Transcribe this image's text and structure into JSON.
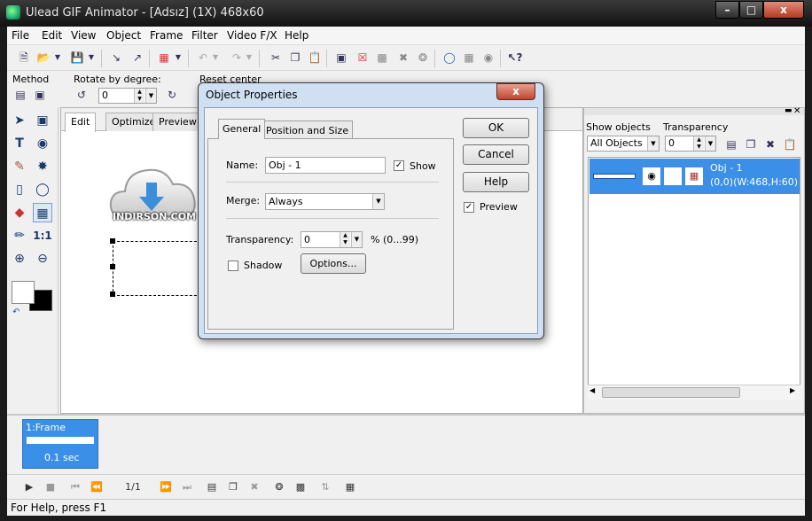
{
  "window": {
    "title": "Ulead GIF Animator - [Adsız] (1X) 468x60",
    "min_label": "–",
    "max_label": "□",
    "close_label": "x"
  },
  "menu": [
    "File",
    "Edit",
    "View",
    "Object",
    "Frame",
    "Filter",
    "Video F/X",
    "Help"
  ],
  "propbar": {
    "method_label": "Method",
    "rotate_label": "Rotate by degree:",
    "rotate_value": "0",
    "reset_label": "Reset center"
  },
  "workspace": {
    "tabs": [
      "Edit",
      "Optimize",
      "Preview"
    ],
    "logo_text": "INDIRSON.COM"
  },
  "objects_panel": {
    "show_label": "Show objects",
    "transparency_label": "Transparency",
    "show_value": "All Objects",
    "transparency_value": "0",
    "object": {
      "name": "Obj - 1",
      "info": "(0,0)(W:468,H:60)"
    }
  },
  "timeline": {
    "frame_label": "1:Frame",
    "frame_delay": "0.1 sec",
    "frame_counter": "1/1"
  },
  "status": "For Help, press F1",
  "dialog": {
    "title": "Object Properties",
    "close_label": "x",
    "tabs": [
      "General",
      "Position and Size"
    ],
    "name_label": "Name:",
    "name_value": "Obj - 1",
    "show_label": "Show",
    "merge_label": "Merge:",
    "merge_value": "Always",
    "transparency_label": "Transparency:",
    "transparency_value": "0",
    "transparency_range": "% (0...99)",
    "shadow_label": "Shadow",
    "options_label": "Options...",
    "ok_label": "OK",
    "cancel_label": "Cancel",
    "help_label": "Help",
    "preview_label": "Preview"
  }
}
